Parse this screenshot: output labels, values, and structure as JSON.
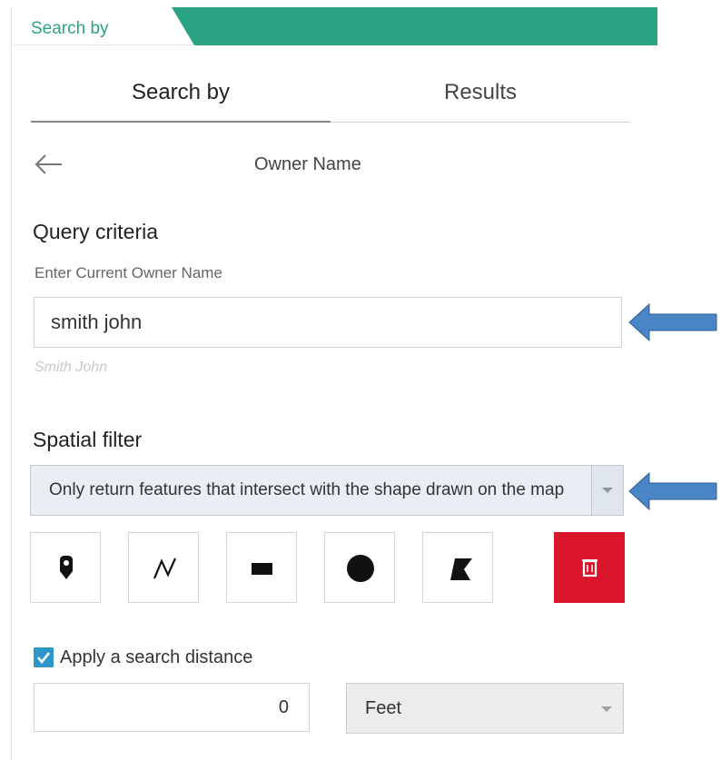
{
  "panel": {
    "title": "Search by",
    "accent_color": "#2aa383"
  },
  "tabs": [
    {
      "label": "Search by",
      "active": true
    },
    {
      "label": "Results",
      "active": false
    }
  ],
  "query": {
    "title": "Owner Name",
    "criteria_heading": "Query criteria",
    "field_label": "Enter Current Owner Name",
    "field_value": "smith john",
    "field_hint": "Smith John"
  },
  "spatial": {
    "heading": "Spatial filter",
    "selected_option": "Only return features that intersect with the shape drawn on the map",
    "tools": [
      {
        "name": "point",
        "icon": "pin-icon"
      },
      {
        "name": "polyline",
        "icon": "polyline-icon"
      },
      {
        "name": "rectangle",
        "icon": "rectangle-icon"
      },
      {
        "name": "circle",
        "icon": "circle-icon"
      },
      {
        "name": "polygon",
        "icon": "polygon-icon"
      },
      {
        "name": "clear",
        "icon": "trash-icon",
        "color": "#d9142b"
      }
    ]
  },
  "distance": {
    "checkbox_label": "Apply a search distance",
    "checked": true,
    "value": "0",
    "unit": "Feet"
  },
  "annotations": {
    "arrow_color": "#4a86c5"
  }
}
